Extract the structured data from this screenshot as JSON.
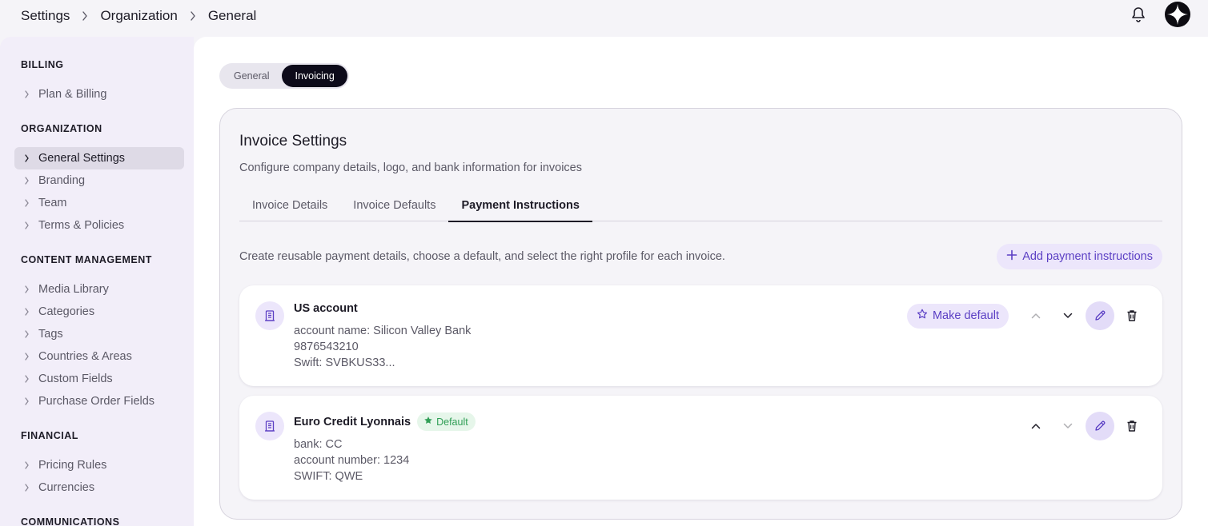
{
  "breadcrumb": [
    "Settings",
    "Organization",
    "General"
  ],
  "sidebar": {
    "sections": [
      {
        "title": "BILLING",
        "items": [
          "Plan & Billing"
        ]
      },
      {
        "title": "ORGANIZATION",
        "items": [
          "General Settings",
          "Branding",
          "Team",
          "Terms & Policies"
        ]
      },
      {
        "title": "CONTENT MANAGEMENT",
        "items": [
          "Media Library",
          "Categories",
          "Tags",
          "Countries & Areas",
          "Custom Fields",
          "Purchase Order Fields"
        ]
      },
      {
        "title": "FINANCIAL",
        "items": [
          "Pricing Rules",
          "Currencies"
        ]
      },
      {
        "title": "COMMUNICATIONS",
        "items": []
      }
    ],
    "active_item": "General Settings"
  },
  "segment": {
    "general": "General",
    "invoicing": "Invoicing",
    "active": "Invoicing"
  },
  "settings": {
    "title": "Invoice Settings",
    "subtitle": "Configure company details, logo, and bank information for invoices",
    "tabs": [
      "Invoice Details",
      "Invoice Defaults",
      "Payment Instructions"
    ],
    "active_tab": "Payment Instructions",
    "description": "Create reusable payment details, choose a default, and select the right profile for each invoice.",
    "add_label": "Add payment instructions"
  },
  "payments": [
    {
      "name": "US account",
      "lines": [
        "account name: Silicon Valley Bank",
        "9876543210",
        "Swift: SVBKUS33..."
      ],
      "is_default": false,
      "make_default_label": "Make default"
    },
    {
      "name": "Euro Credit Lyonnais",
      "lines": [
        "bank: CC",
        "account number: 1234",
        "SWIFT: QWE"
      ],
      "is_default": true,
      "default_label": "Default"
    }
  ],
  "colors": {
    "accent": "#5b3fc4",
    "accent_bg": "#ece6fb",
    "default_green": "#2f9e55",
    "active_segment": "#0d0b1a"
  }
}
